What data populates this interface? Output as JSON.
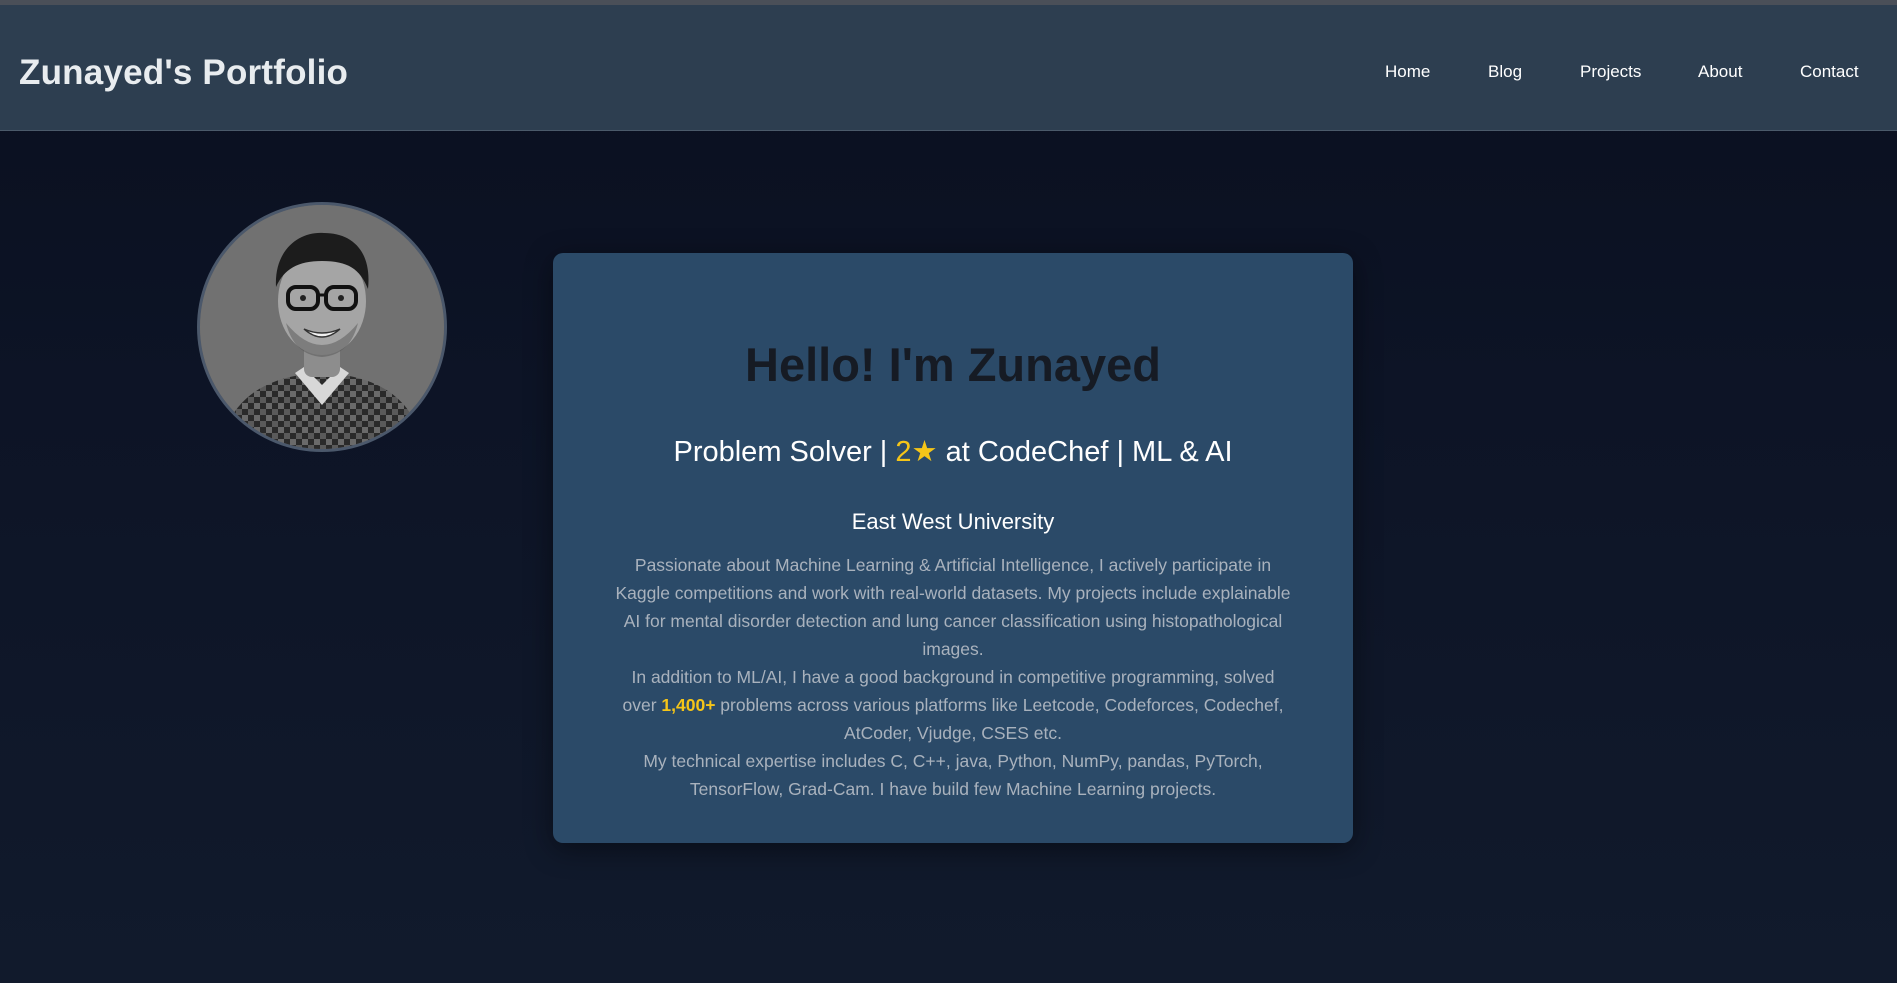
{
  "header": {
    "brand": "Zunayed's Portfolio",
    "nav": [
      {
        "label": "Home"
      },
      {
        "label": "Blog"
      },
      {
        "label": "Projects"
      },
      {
        "label": "About"
      },
      {
        "label": "Contact"
      }
    ]
  },
  "profile": {
    "avatar_icon": "profile-photo",
    "greeting": "Hello! I'm Zunayed",
    "tagline": {
      "prefix": "Problem Solver | ",
      "rating": "2★",
      "suffix": " at CodeChef | ML & AI"
    },
    "university": "East West University",
    "bio": {
      "paragraph1": "Passionate about Machine Learning & Artificial Intelligence, I actively participate in Kaggle competitions and work with real-world datasets. My projects include explainable AI for mental disorder detection and lung cancer classification using histopathological images.",
      "paragraph2_prefix": "In addition to ML/AI, I have a good background in competitive programming, solved over ",
      "paragraph2_highlight": "1,400+",
      "paragraph2_suffix": " problems across various platforms like Leetcode, Codeforces, Codechef, AtCoder, Vjudge, CSES etc.",
      "paragraph3": "My technical expertise includes C, C++, java, Python, NumPy, pandas, PyTorch, TensorFlow, Grad-Cam. I have build few Machine Learning projects."
    }
  },
  "colors": {
    "navbar": "#2d3e50",
    "card": "#2b4a68",
    "highlight": "#f5c518",
    "background": "#0d1426"
  }
}
